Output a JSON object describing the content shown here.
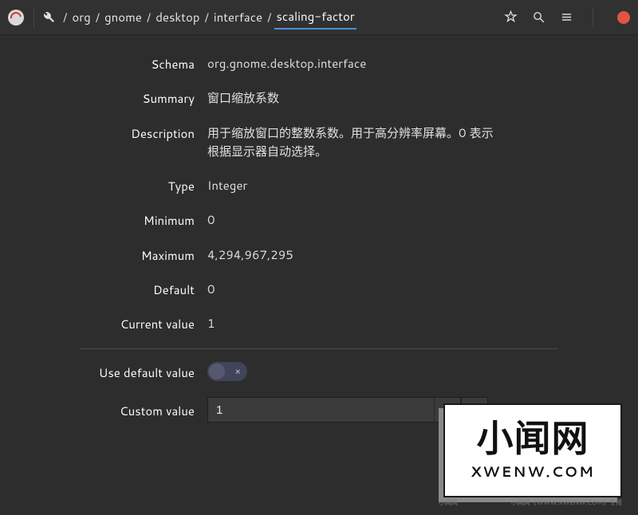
{
  "breadcrumbs": [
    "org",
    "gnome",
    "desktop",
    "interface",
    "scaling-factor"
  ],
  "active_crumb_index": 4,
  "details": {
    "labels": {
      "schema": "Schema",
      "summary": "Summary",
      "description": "Description",
      "type": "Type",
      "minimum": "Minimum",
      "maximum": "Maximum",
      "default": "Default",
      "current_value": "Current value",
      "use_default_value": "Use default value",
      "custom_value": "Custom value"
    },
    "values": {
      "schema": "org.gnome.desktop.interface",
      "summary": "窗口缩放系数",
      "description": "用于缩放窗口的整数系数。用于高分辨率屏幕。0 表示根据显示器自动选择。",
      "type": "Integer",
      "minimum": "0",
      "maximum": "4,294,967,295",
      "default": "0",
      "current_value": "1"
    }
  },
  "use_default_value": false,
  "custom_value": "1",
  "spin": {
    "minus": "−",
    "plus": "+"
  },
  "switch": {
    "off_glyph": "×"
  },
  "watermark": {
    "big": "小闻网",
    "small": "XWENW.COM",
    "foot_left": "小闻网",
    "foot_right": "小闻网《WWW.XWENW.COM》专用"
  }
}
